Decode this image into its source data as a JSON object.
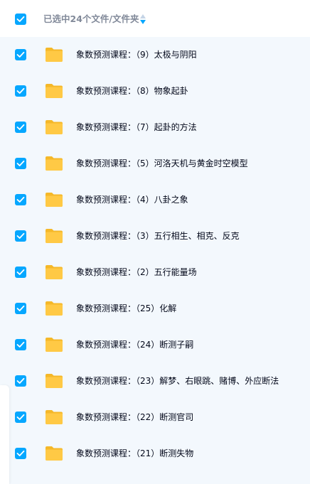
{
  "header": {
    "select_all_checked": true,
    "selection_label": "已选中24个文件/文件夹"
  },
  "colors": {
    "accent": "#06a7ff",
    "folder": "#ffc945",
    "list_background": "#f3f8fd",
    "text": "#03081a",
    "muted_text": "#818999"
  },
  "files": [
    {
      "name": "象数预测课程：（9）太极与阴阳",
      "checked": true,
      "icon": "folder-icon"
    },
    {
      "name": "象数预测课程：（8）物象起卦",
      "checked": true,
      "icon": "folder-icon"
    },
    {
      "name": "象数预测课程：（7）起卦的方法",
      "checked": true,
      "icon": "folder-icon"
    },
    {
      "name": "象数预测课程：（5）河洛天机与黄金时空模型",
      "checked": true,
      "icon": "folder-icon"
    },
    {
      "name": "象数预测课程：（4）八卦之象",
      "checked": true,
      "icon": "folder-icon"
    },
    {
      "name": "象数预测课程：（3）五行相生、相克、反克",
      "checked": true,
      "icon": "folder-icon"
    },
    {
      "name": "象数预测课程：（2）五行能量场",
      "checked": true,
      "icon": "folder-icon"
    },
    {
      "name": "象数预测课程：（25）化解",
      "checked": true,
      "icon": "folder-icon"
    },
    {
      "name": "象数预测课程：（24）断测子嗣",
      "checked": true,
      "icon": "folder-icon"
    },
    {
      "name": "象数预测课程：（23）解梦、右眼跳、赌博、外应断法",
      "checked": true,
      "icon": "folder-icon"
    },
    {
      "name": "象数预测课程：（22）断测官司",
      "checked": true,
      "icon": "folder-icon"
    },
    {
      "name": "象数预测课程：（21）断测失物",
      "checked": true,
      "icon": "folder-icon"
    }
  ]
}
